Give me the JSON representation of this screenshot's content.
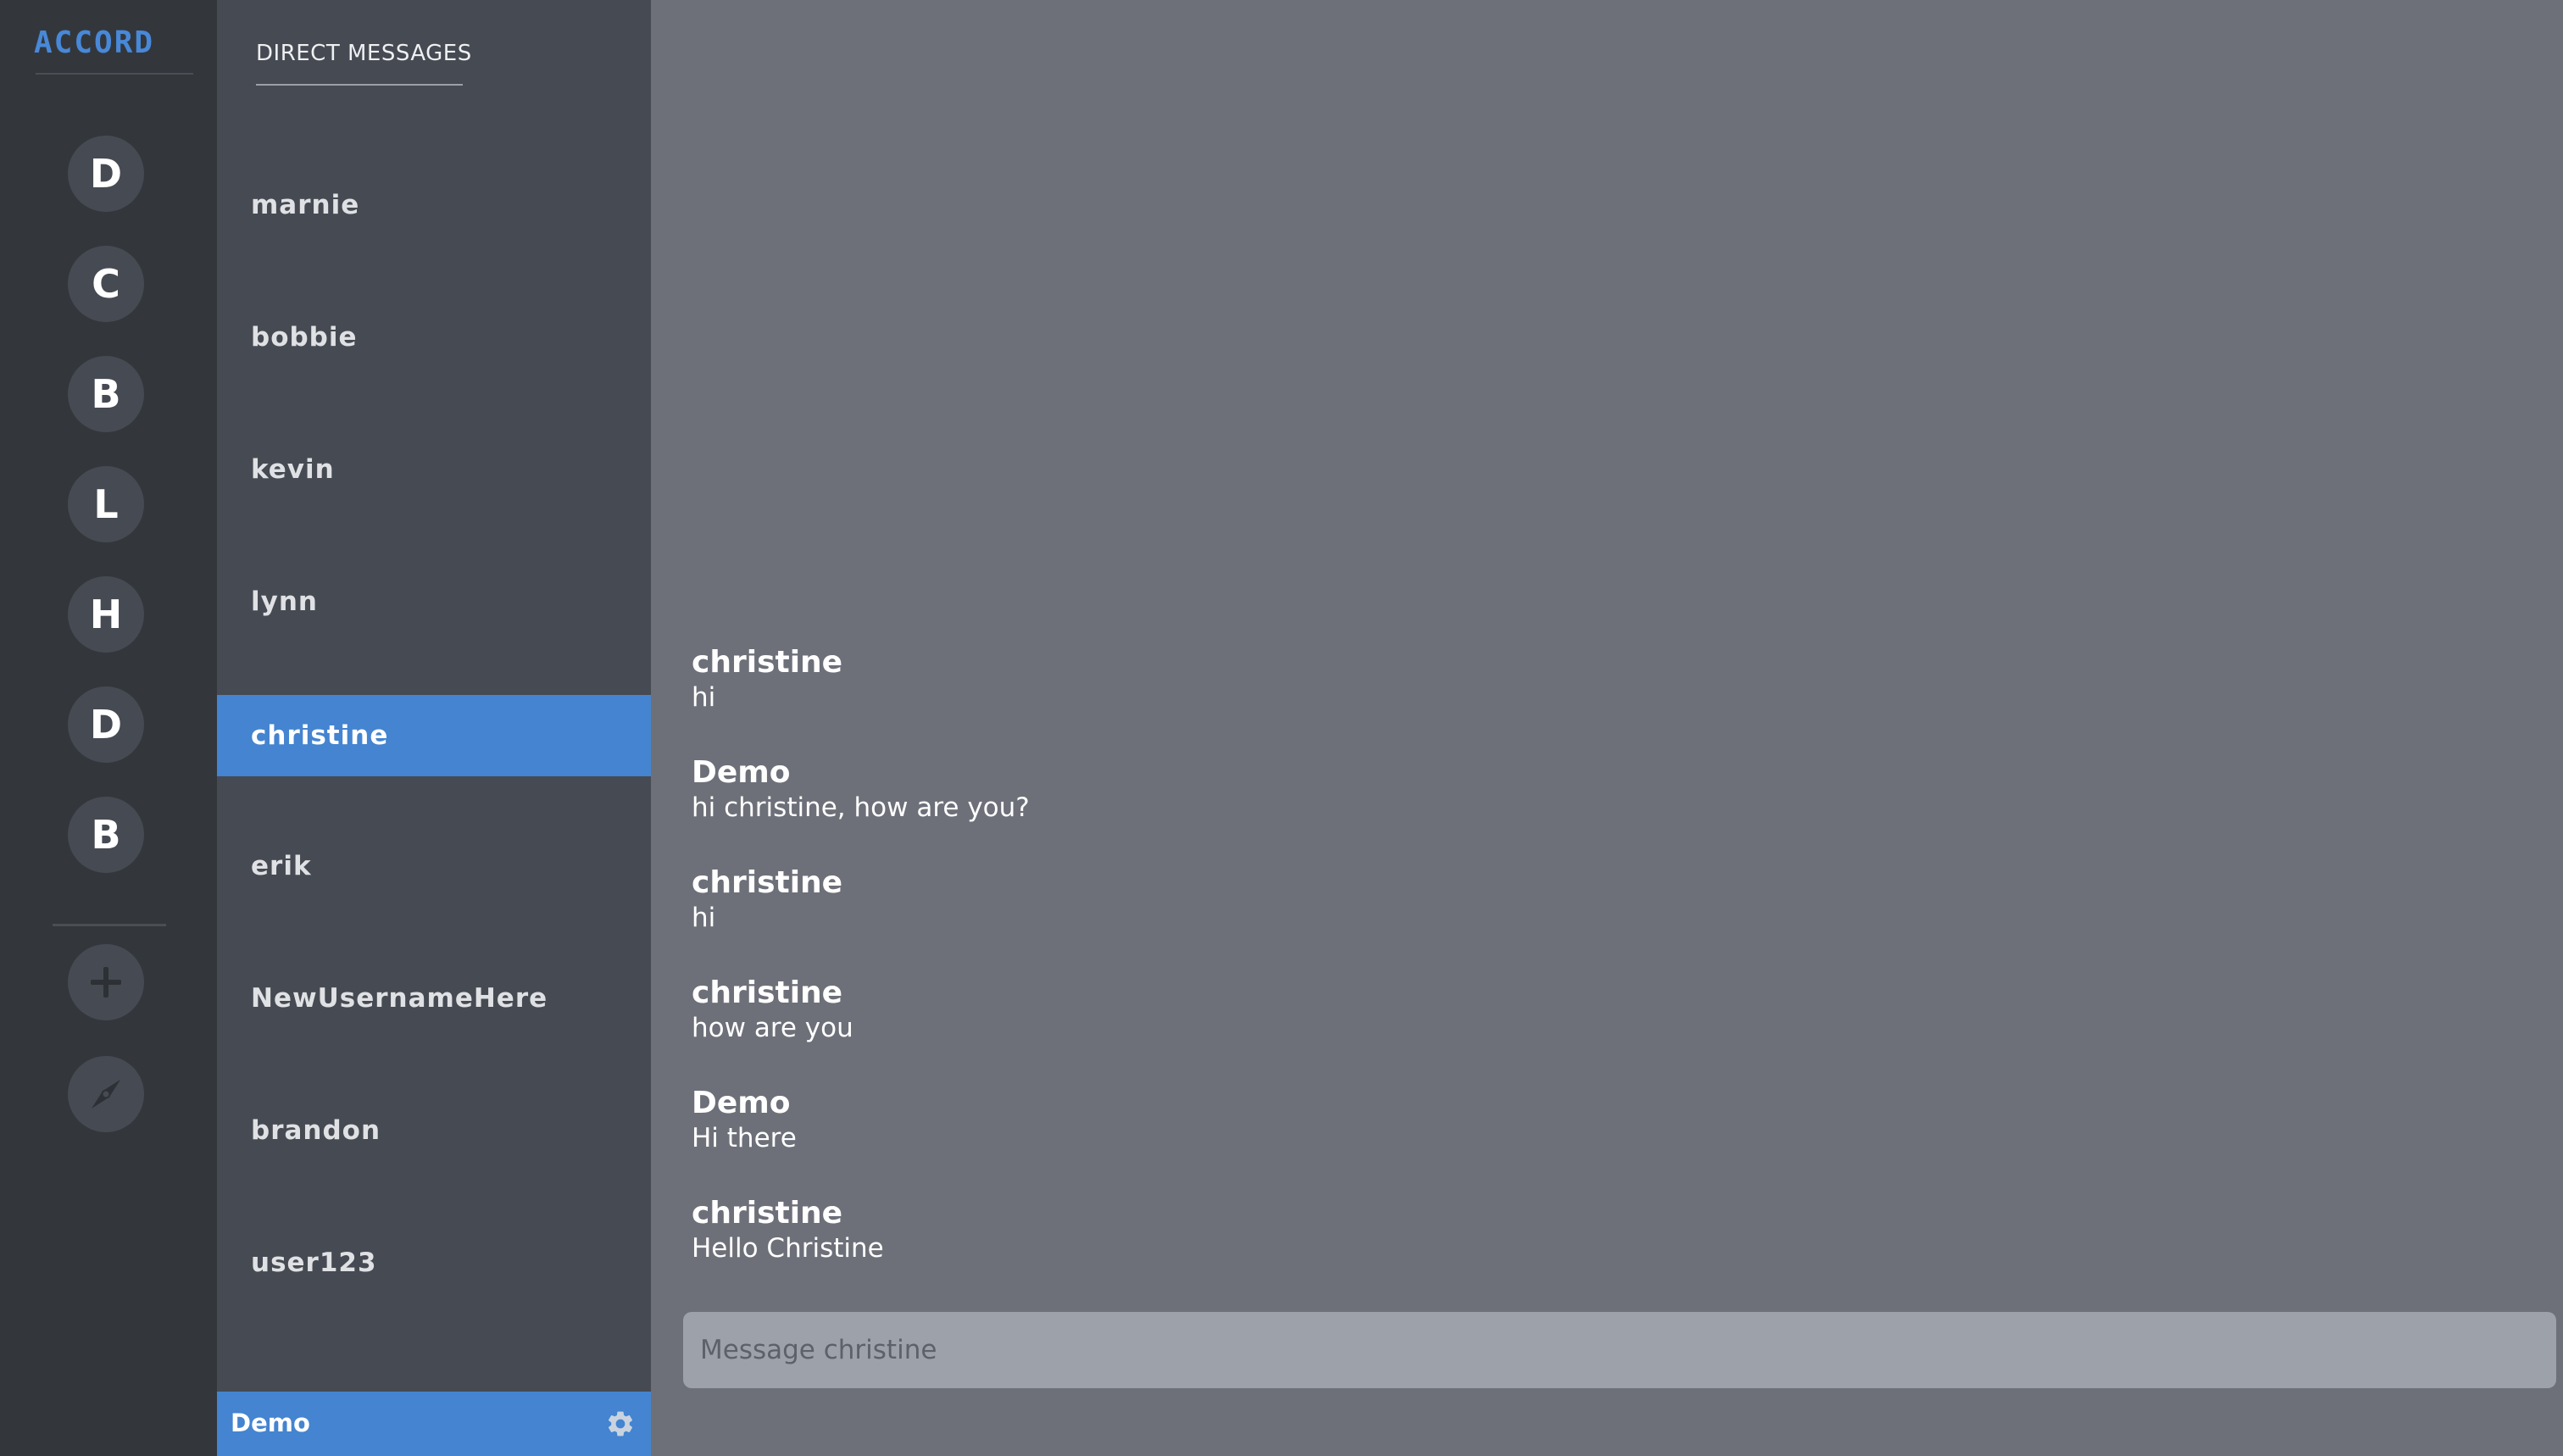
{
  "app": {
    "logo": "ACCORD",
    "accent_color": "#4484d0"
  },
  "servers": [
    {
      "initial": "D"
    },
    {
      "initial": "C"
    },
    {
      "initial": "B"
    },
    {
      "initial": "L"
    },
    {
      "initial": "H"
    },
    {
      "initial": "D"
    },
    {
      "initial": "B"
    }
  ],
  "rail_actions": {
    "add_icon": "plus-icon",
    "explore_icon": "compass-icon"
  },
  "direct_messages": {
    "header": "DIRECT MESSAGES",
    "items": [
      {
        "name": "marnie"
      },
      {
        "name": "bobbie"
      },
      {
        "name": "kevin"
      },
      {
        "name": "lynn"
      },
      {
        "name": "christine",
        "active": true
      },
      {
        "name": "erik"
      },
      {
        "name": "NewUsernameHere"
      },
      {
        "name": "brandon"
      },
      {
        "name": "user123"
      }
    ]
  },
  "current_user": {
    "name": "Demo",
    "settings_icon": "gear-icon"
  },
  "chat": {
    "messages": [
      {
        "author": "christine",
        "text": "hi"
      },
      {
        "author": "Demo",
        "text": "hi christine, how are you?"
      },
      {
        "author": "christine",
        "text": "hi"
      },
      {
        "author": "christine",
        "text": "how are you"
      },
      {
        "author": "Demo",
        "text": "Hi there"
      },
      {
        "author": "christine",
        "text": "Hello Christine"
      }
    ],
    "composer_placeholder": "Message christine",
    "composer_value": ""
  }
}
